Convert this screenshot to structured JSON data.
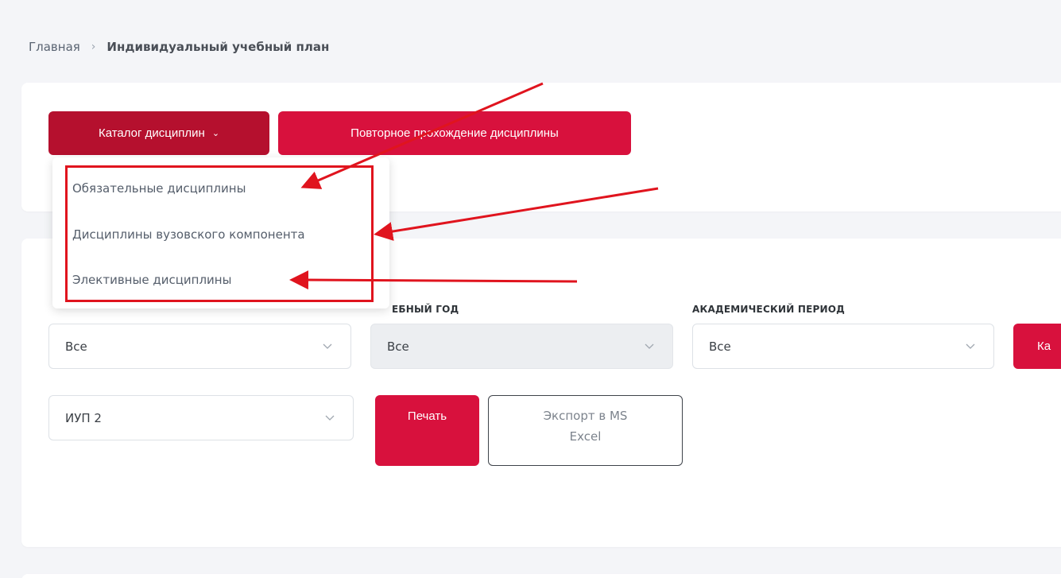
{
  "breadcrumb": {
    "home": "Главная",
    "separator": "›",
    "current": "Индивидуальный учебный план"
  },
  "toolbar": {
    "catalog_label": "Каталог дисциплин",
    "catalog_chevron": "⌄",
    "retake_label": "Повторное прохождение дисциплины"
  },
  "catalog_menu": {
    "items": [
      {
        "label": "Обязательные дисциплины"
      },
      {
        "label": "Дисциплины вузовского компонента"
      },
      {
        "label": "Элективные дисциплины"
      }
    ]
  },
  "filters": {
    "year_label": "ЕБНЫЙ ГОД",
    "period_label": "АКАДЕМИЧЕСКИЙ ПЕРИОД",
    "select1_value": "Все",
    "year_value": "Все",
    "period_value": "Все",
    "catalog_button_label": "Ка",
    "iup_value": "ИУП 2",
    "print_label": "Печать",
    "export_line1": "Экспорт в MS",
    "export_line2": "Excel"
  },
  "colors": {
    "brand_red": "#d8113d",
    "brand_red_dark": "#b5102e",
    "annotation_red": "#e0141e",
    "background": "#f4f5f8"
  },
  "icons": {
    "chevron": "chevron-down-icon",
    "breadcrumb_separator": "chevron-right-icon"
  }
}
